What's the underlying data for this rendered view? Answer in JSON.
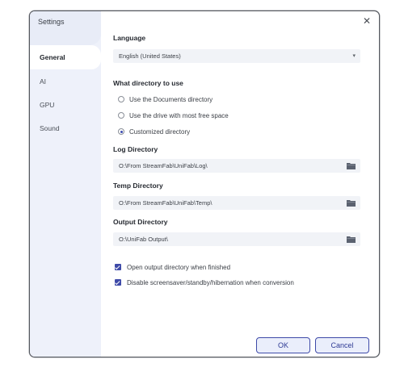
{
  "window": {
    "title": "Settings"
  },
  "sidebar": {
    "items": [
      {
        "label": "General",
        "active": true
      },
      {
        "label": "AI"
      },
      {
        "label": "GPU"
      },
      {
        "label": "Sound"
      }
    ]
  },
  "language": {
    "label": "Language",
    "value": "English (United States)"
  },
  "directory": {
    "label": "What directory to use",
    "options": [
      {
        "label": "Use the Documents directory",
        "checked": false
      },
      {
        "label": "Use the drive with most free space",
        "checked": false
      },
      {
        "label": "Customized directory",
        "checked": true
      }
    ]
  },
  "log_dir": {
    "label": "Log Directory",
    "value": "O:\\From StreamFab\\UniFab\\Log\\"
  },
  "temp_dir": {
    "label": "Temp Directory",
    "value": "O:\\From StreamFab\\UniFab\\Temp\\"
  },
  "output_dir": {
    "label": "Output Directory",
    "value": "O:\\UniFab Output\\"
  },
  "options": {
    "open_output": {
      "label": "Open output directory when finished",
      "checked": true
    },
    "disable_screensaver": {
      "label": "Disable screensaver/standby/hibernation when conversion",
      "checked": true
    }
  },
  "buttons": {
    "ok": "OK",
    "cancel": "Cancel"
  },
  "colors": {
    "accent": "#3e4aa8",
    "sidebar_bg": "#eef1fa",
    "field_bg": "#f1f3f7"
  }
}
